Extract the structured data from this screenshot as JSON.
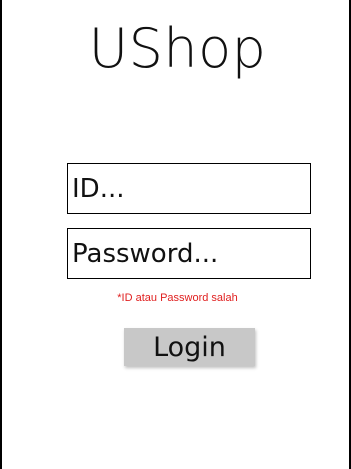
{
  "app": {
    "title": "UShop"
  },
  "form": {
    "id_placeholder": "ID...",
    "password_placeholder": "Password...",
    "error_message": "*ID atau Password salah",
    "login_label": "Login"
  },
  "colors": {
    "error": "#e02020",
    "button_bg": "#c8c8c8"
  }
}
